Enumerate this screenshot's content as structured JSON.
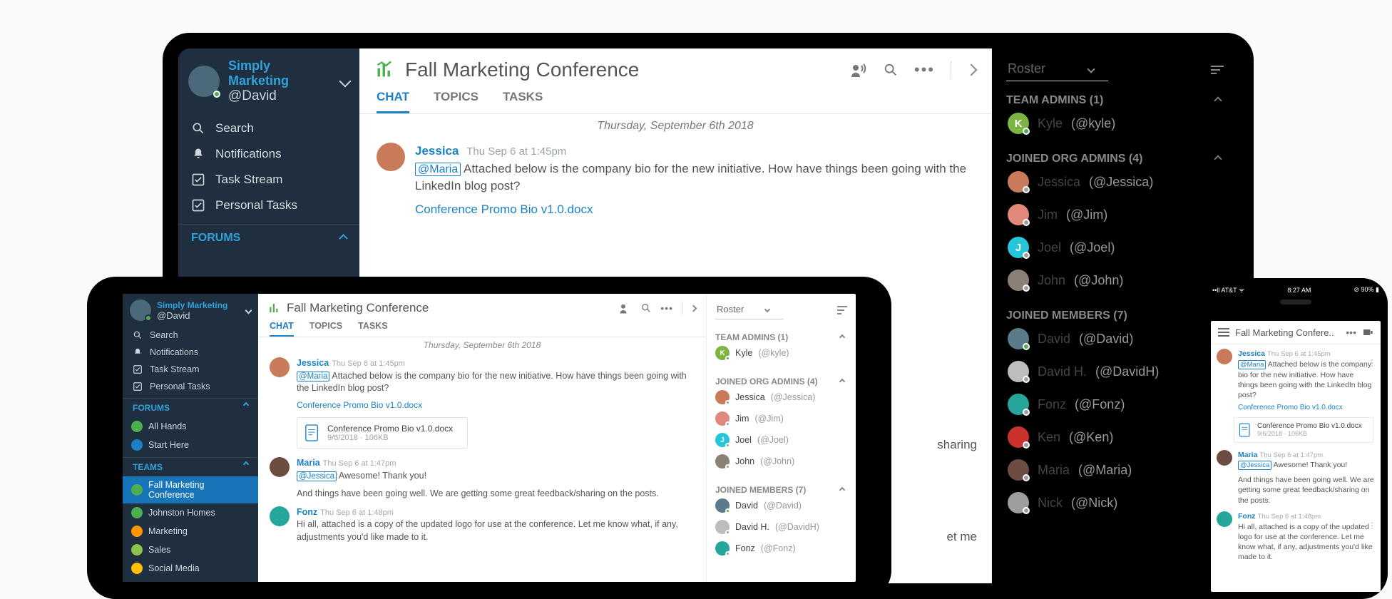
{
  "org": {
    "name": "Simply Marketing",
    "user_handle": "@David"
  },
  "nav": {
    "search": "Search",
    "notifications": "Notifications",
    "task_stream": "Task Stream",
    "personal_tasks": "Personal Tasks"
  },
  "forums_section": "FORUMS",
  "forums": {
    "all_hands": "All Hands",
    "start_here": "Start Here"
  },
  "teams_section": "TEAMS",
  "teams": {
    "fall_marketing": "Fall Marketing Conference",
    "johnston_homes": "Johnston Homes",
    "marketing": "Marketing",
    "sales": "Sales",
    "social_media": "Social Media"
  },
  "page": {
    "title": "Fall Marketing Conference",
    "tabs": {
      "chat": "CHAT",
      "topics": "TOPICS",
      "tasks": "TASKS"
    },
    "date_divider": "Thursday, September 6th 2018"
  },
  "messages": [
    {
      "author": "Jessica",
      "ts": "Thu Sep 6 at 1:45pm",
      "mention": "@Maria",
      "text": "Attached below is the company bio for the new initiative. How have things been going with the LinkedIn blog post?",
      "file_link": "Conference Promo Bio v1.0.docx",
      "file_meta": "9/6/2018 · 106KB"
    },
    {
      "author": "Maria",
      "ts": "Thu Sep 6 at 1:47pm",
      "mention": "@Jessica",
      "text": "Awesome! Thank you!",
      "text2": "And things have been going well. We are getting some great feedback/sharing on the posts."
    },
    {
      "author": "Fonz",
      "ts": "Thu Sep 6 at 1:48pm",
      "text": "Hi all, attached is a copy of the updated logo for use at the conference. Let me know what, if any, adjustments you'd like made to it."
    }
  ],
  "laptop_trunc": {
    "l1": "sharing",
    "l2": "et me"
  },
  "roster": {
    "selector": "Roster",
    "groups": {
      "admins": {
        "label": "TEAM ADMINS (1)",
        "items": [
          {
            "name": "Kyle",
            "handle": "(@kyle)",
            "color": "#7cb342"
          }
        ]
      },
      "org_admins": {
        "label": "JOINED ORG ADMINS (4)",
        "items": [
          {
            "name": "Jessica",
            "handle": "(@Jessica)",
            "color": "#c97a5a"
          },
          {
            "name": "Jim",
            "handle": "(@Jim)",
            "color": "#e0897a"
          },
          {
            "name": "Joel",
            "handle": "(@Joel)",
            "color": "#26c6da"
          },
          {
            "name": "John",
            "handle": "(@John)",
            "color": "#8b8075"
          }
        ]
      },
      "members": {
        "label": "JOINED MEMBERS (7)",
        "items": [
          {
            "name": "David",
            "handle": "(@David)",
            "color": "#5b7a8a"
          },
          {
            "name": "David H.",
            "handle": "(@DavidH)",
            "color": "#bdbdbd"
          },
          {
            "name": "Fonz",
            "handle": "(@Fonz)",
            "color": "#26a69a"
          },
          {
            "name": "Ken",
            "handle": "(@Ken)",
            "color": "#c9322d"
          },
          {
            "name": "Maria",
            "handle": "(@Maria)",
            "color": "#6d4c41"
          },
          {
            "name": "Nick",
            "handle": "(@Nick)",
            "color": "#9e9e9e"
          }
        ]
      }
    }
  },
  "phone": {
    "carrier": "AT&T",
    "time": "8:27 AM",
    "battery": "90%",
    "title": "Fall Marketing Confere.."
  }
}
